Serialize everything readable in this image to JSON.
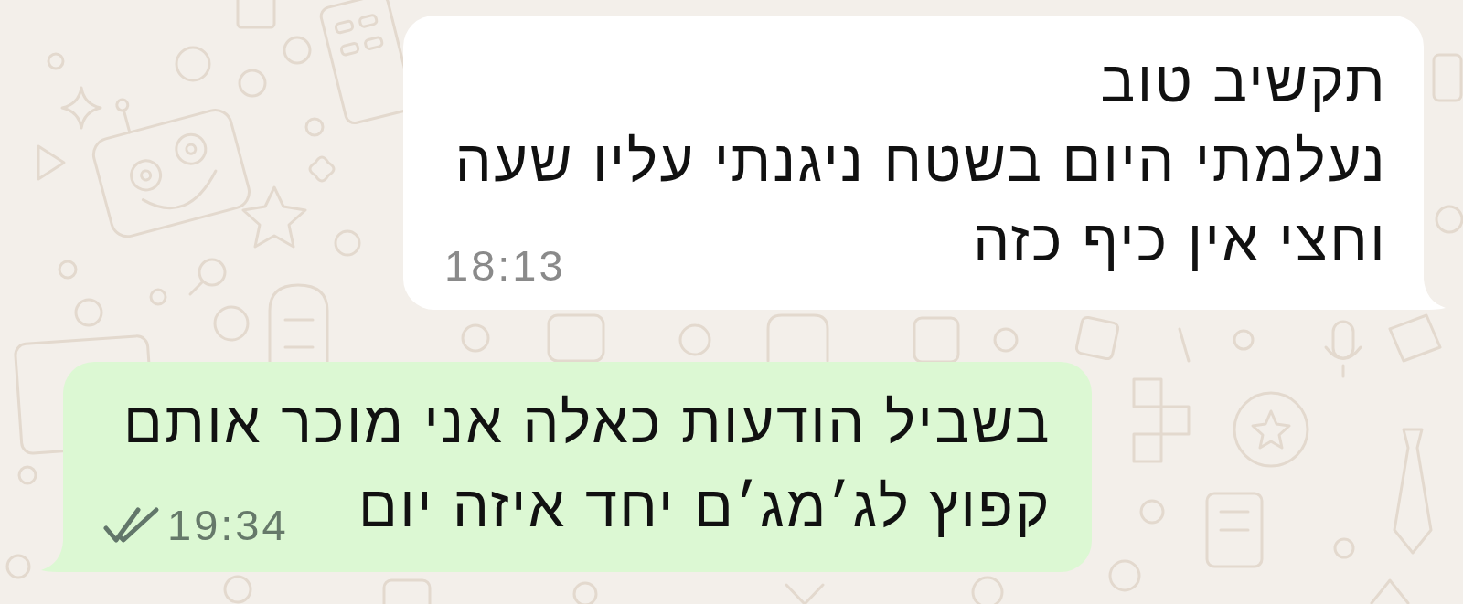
{
  "messages": [
    {
      "kind": "incoming",
      "lines": [
        "תקשיב טוב",
        "נעלמתי היום בשטח ניגנתי עליו שעה",
        "וחצי אין כיף כזה"
      ],
      "time": "18:13"
    },
    {
      "kind": "outgoing",
      "lines": [
        "בשביל הודעות כאלה אני מוכר אותם",
        "קפוץ לג׳מג׳ם יחד איזה יום"
      ],
      "time": "19:34",
      "delivered": true,
      "read": false
    }
  ]
}
